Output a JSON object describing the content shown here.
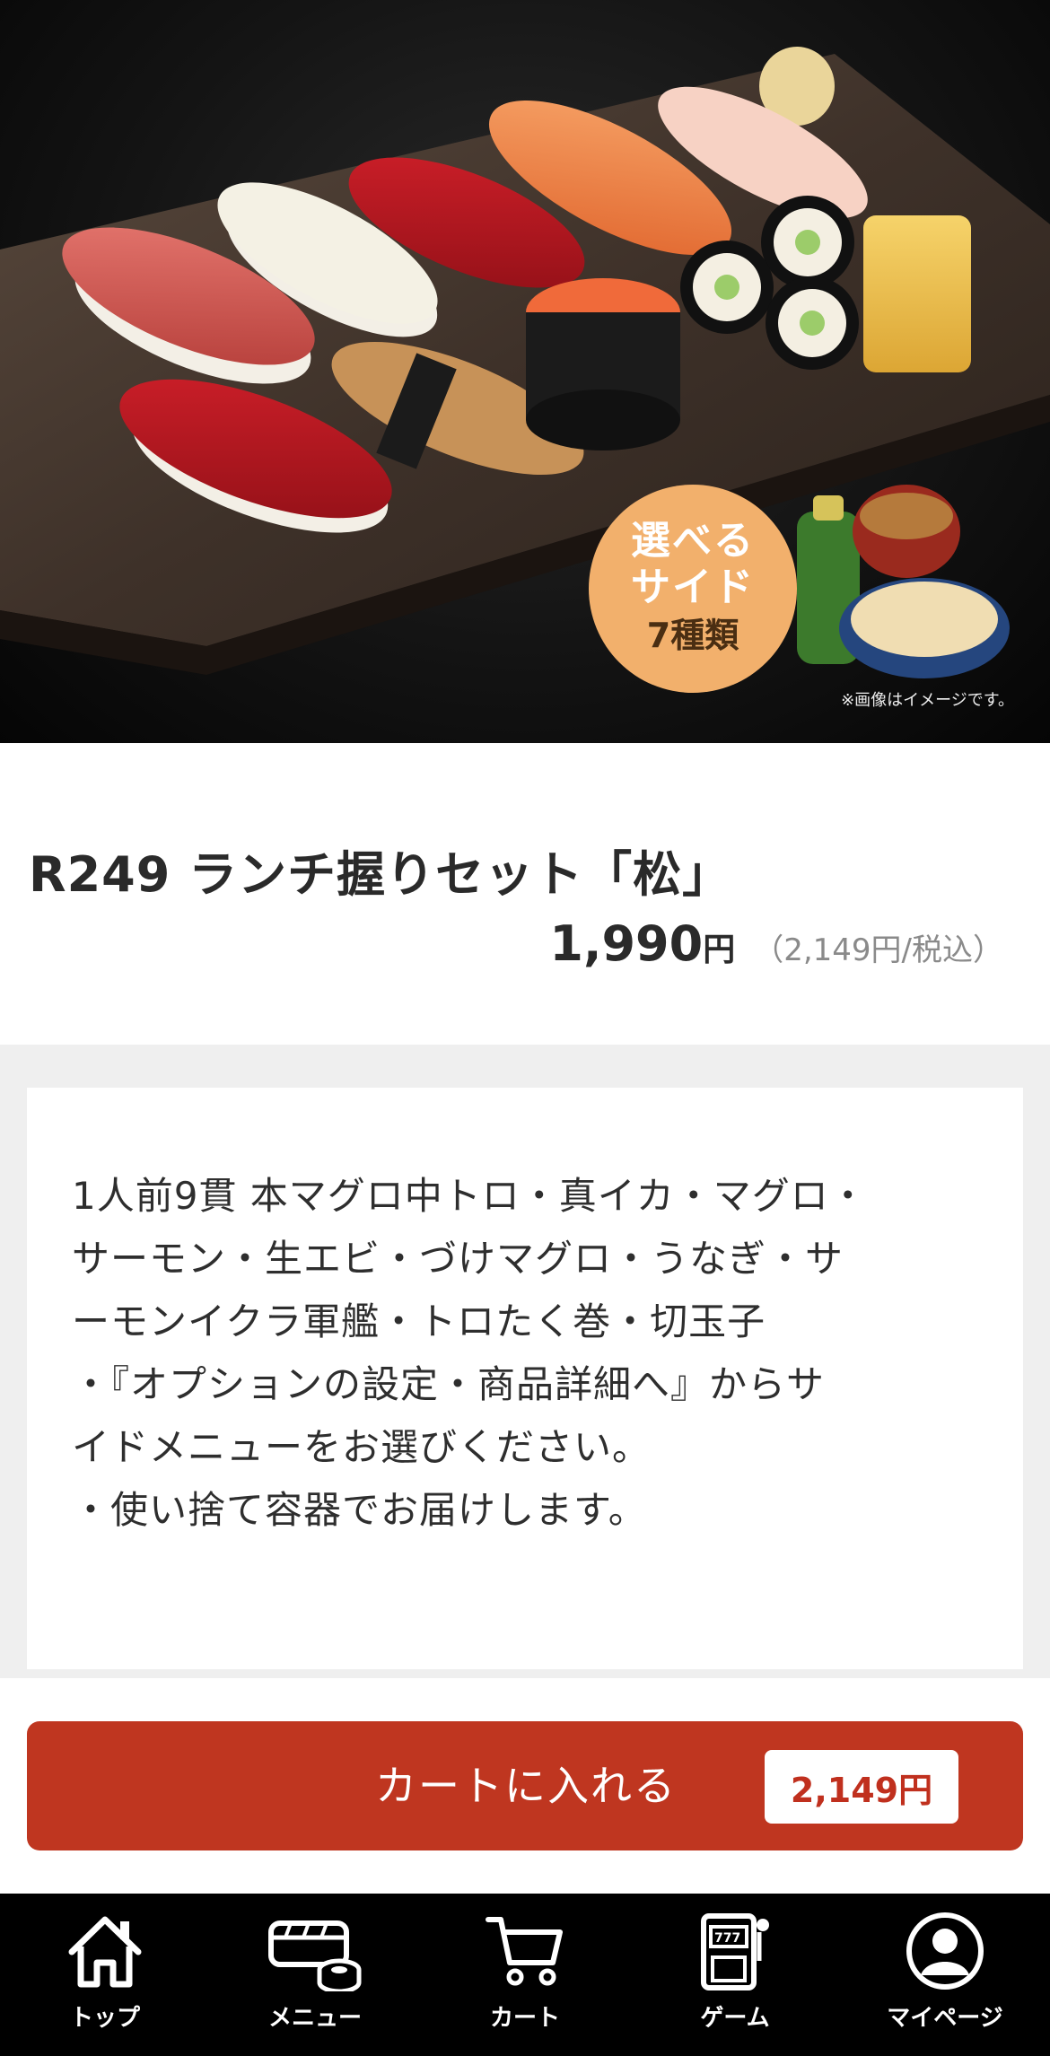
{
  "hero": {
    "badge_line1": "選べる",
    "badge_line2": "サイド",
    "badge_line3": "7種類",
    "note": "※画像はイメージです。"
  },
  "product": {
    "title": "R249 ランチ握りセット「松」",
    "price": "1,990",
    "price_unit": "円",
    "price_tax_included": "（2,149円/税込）"
  },
  "description": {
    "lines": [
      "1人前9貫 本マグロ中トロ・真イカ・マグロ・",
      "サーモン・生エビ・づけマグロ・うなぎ・サ",
      "ーモンイクラ軍艦・トロたく巻・切玉子",
      "・『オプションの設定・商品詳細へ』からサ",
      "イドメニューをお選びください。",
      "・使い捨て容器でお届けします。"
    ]
  },
  "cart_button": {
    "label": "カートに入れる",
    "price": "2,149円"
  },
  "bottom_nav": {
    "items": [
      {
        "label": "トップ",
        "icon": "home-icon"
      },
      {
        "label": "メニュー",
        "icon": "sushi-menu-icon"
      },
      {
        "label": "カート",
        "icon": "cart-icon"
      },
      {
        "label": "ゲーム",
        "icon": "slot-machine-icon"
      },
      {
        "label": "マイページ",
        "icon": "user-icon"
      }
    ]
  },
  "colors": {
    "accent": "#bf3620",
    "badge": "#f2b06c",
    "nav_background": "#000000",
    "description_background": "#efefef"
  }
}
